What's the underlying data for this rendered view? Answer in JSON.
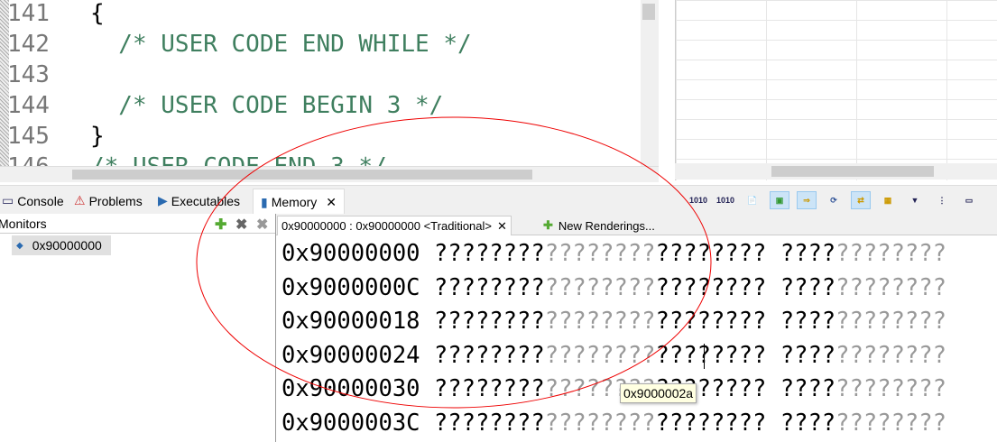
{
  "editor": {
    "lines": [
      {
        "num": "141",
        "text": "{",
        "comment": false
      },
      {
        "num": "142",
        "text": "  /* USER CODE END WHILE */",
        "comment": true
      },
      {
        "num": "143",
        "text": "",
        "comment": false
      },
      {
        "num": "144",
        "text": "  /* USER CODE BEGIN 3 */",
        "comment": true
      },
      {
        "num": "145",
        "text": "}",
        "comment": false
      },
      {
        "num": "146",
        "text": "/* USER CODE END 3 */",
        "comment": true
      }
    ]
  },
  "tabs": [
    {
      "label": "Console",
      "icon": "console-icon"
    },
    {
      "label": "Problems",
      "icon": "problems-icon"
    },
    {
      "label": "Executables",
      "icon": "executables-icon"
    },
    {
      "label": "Memory",
      "icon": "memory-icon",
      "active": true
    }
  ],
  "monitors": {
    "title": "Monitors",
    "items": [
      "0x90000000"
    ]
  },
  "renderings": {
    "tabs": [
      "0x90000000 : 0x90000000 <Traditional>",
      "New Renderings..."
    ],
    "rows": [
      {
        "addr": "0x90000000",
        "a": "????????",
        "b": "????????",
        "c": "????????",
        "d": "????",
        "e": "????????"
      },
      {
        "addr": "0x9000000C",
        "a": "????????",
        "b": "????????",
        "c": "????????",
        "d": "????",
        "e": "????????"
      },
      {
        "addr": "0x90000018",
        "a": "????????",
        "b": "????????",
        "c": "????????",
        "d": "????",
        "e": "????????"
      },
      {
        "addr": "0x90000024",
        "a": "????????",
        "b": "????????",
        "c": "????????",
        "d": "????",
        "e": "????????"
      },
      {
        "addr": "0x90000030",
        "a": "????????",
        "b": "????????",
        "c": "????????",
        "d": "????",
        "e": "????????"
      },
      {
        "addr": "0x9000003C",
        "a": "????????",
        "b": "????????",
        "c": "????????",
        "d": "????",
        "e": "????????"
      }
    ]
  },
  "tooltip": "0x9000002a",
  "toolbar": {
    "b1": "1010",
    "b2": "1010"
  }
}
